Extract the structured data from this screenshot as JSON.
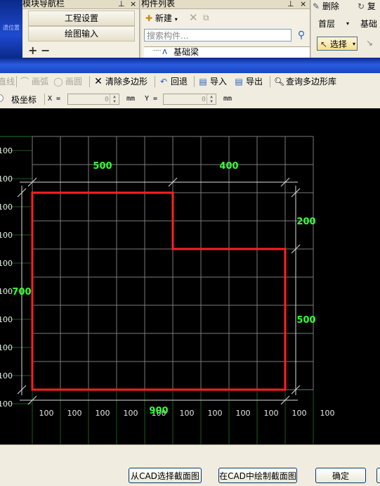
{
  "nav_panel": {
    "title": "模块导航栏",
    "pin": "ꟸ",
    "close": "×",
    "items": [
      "工程设置",
      "绘图输入"
    ],
    "expand": "+",
    "collapse": "−",
    "ghost": "遗位置"
  },
  "component_list": {
    "title": "构件列表",
    "pin": "ꟸ",
    "close": "×",
    "new_label": "新建",
    "search_placeholder": "搜索构件...",
    "tree_item": "基础梁"
  },
  "right_panel": {
    "delete_label": "删除",
    "copy_label": "复",
    "floor_label": "首层",
    "base_label": "基础",
    "select_label": "选择"
  },
  "toolbar": {
    "line": "直线",
    "arc": "画弧",
    "circle": "画圆",
    "clear": "清除多边形",
    "undo": "回退",
    "import": "导入",
    "export": "导出",
    "query": "查询多边形库"
  },
  "coords": {
    "polar": "极坐标",
    "x_label": "X =",
    "x_value": "0",
    "y_label": "Y =",
    "y_value": "0",
    "unit": "mm"
  },
  "grid": {
    "cell_label": "100",
    "cols": 10,
    "rows": 9
  },
  "shape": {
    "color": "#ff2020",
    "dim_color": "#33ff33",
    "dims": {
      "top_left": "500",
      "top_right": "400",
      "right_top": "200",
      "right_bottom": "500",
      "bottom": "900",
      "left": "700"
    }
  },
  "buttons": {
    "from_cad": "从CAD选择截面图",
    "draw_cad": "在CAD中绘制截面图",
    "ok": "确定"
  }
}
